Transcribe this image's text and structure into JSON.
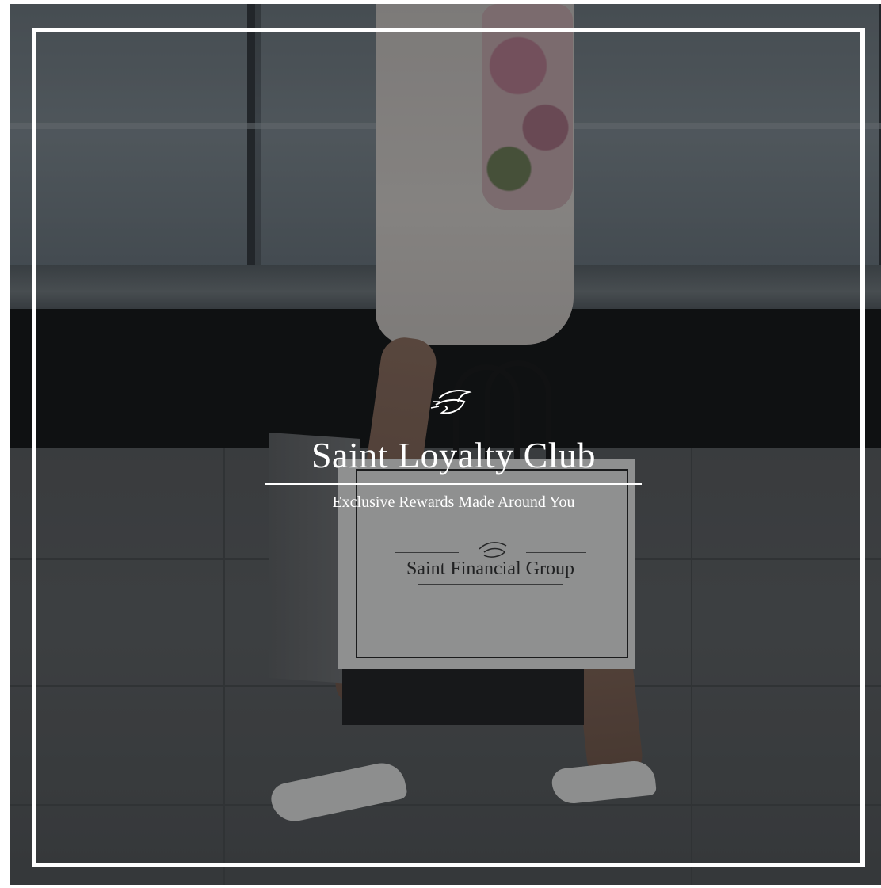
{
  "brand": {
    "title": "Saint Loyalty Club",
    "tagline": "Exclusive Rewards Made Around You",
    "bag_brand": "Saint Financial Group",
    "logo_icon": "bird-icon"
  },
  "colors": {
    "frame": "#ffffff",
    "text": "#ffffff",
    "overlay": "#141618"
  }
}
